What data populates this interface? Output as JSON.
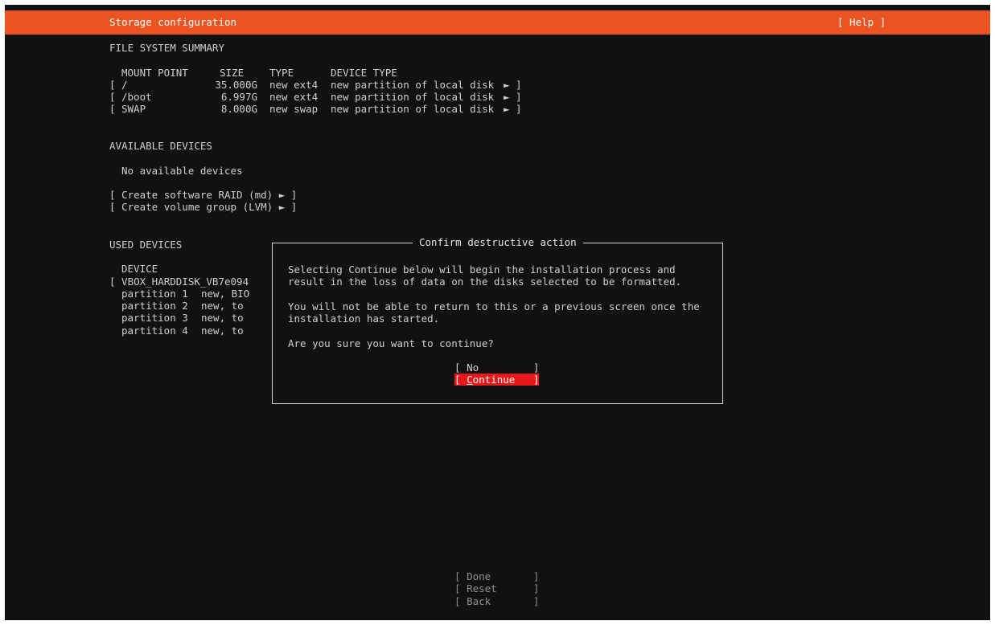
{
  "header": {
    "title": "Storage configuration",
    "help": "[ Help ]"
  },
  "fs_summary": {
    "heading": "FILE SYSTEM SUMMARY",
    "columns": {
      "mount": "MOUNT POINT",
      "size": "SIZE",
      "type": "TYPE",
      "device_type": "DEVICE TYPE"
    },
    "rows": [
      {
        "open": "[",
        "mount": "/",
        "size": "35.000G",
        "type": "new ext4",
        "device_type": "new partition of local disk",
        "arrow": "►",
        "close": "]"
      },
      {
        "open": "[",
        "mount": "/boot",
        "size": "6.997G",
        "type": "new ext4",
        "device_type": "new partition of local disk",
        "arrow": "►",
        "close": "]"
      },
      {
        "open": "[",
        "mount": "SWAP",
        "size": "8.000G",
        "type": "new swap",
        "device_type": "new partition of local disk",
        "arrow": "►",
        "close": "]"
      }
    ]
  },
  "available": {
    "heading": "AVAILABLE DEVICES",
    "empty": "No available devices",
    "actions": [
      "[ Create software RAID (md) ► ]",
      "[ Create volume group (LVM) ► ]"
    ]
  },
  "used": {
    "heading": "USED DEVICES",
    "column": "DEVICE",
    "disk": "[ VBOX_HARDDISK_VB7e094",
    "partitions": [
      {
        "name": "partition 1",
        "info": "new, BIO"
      },
      {
        "name": "partition 2",
        "info": "new, to"
      },
      {
        "name": "partition 3",
        "info": "new, to"
      },
      {
        "name": "partition 4",
        "info": "new, to"
      }
    ]
  },
  "dialog": {
    "title": "Confirm destructive action",
    "line1": "Selecting Continue below will begin the installation process and",
    "line2": "result in the loss of data on the disks selected to be formatted.",
    "line3": "You will not be able to return to this or a previous screen once the",
    "line4": "installation has started.",
    "question": "Are you sure you want to continue?",
    "no": {
      "open": "[ ",
      "label": "No",
      "close": "         ]"
    },
    "continue": {
      "open": "[ ",
      "first": "C",
      "rest": "ontinue",
      "close": "   ]"
    }
  },
  "footer": {
    "done": {
      "open": "[ ",
      "label": "Done",
      "close": "       ]"
    },
    "reset": {
      "open": "[ ",
      "label": "Reset",
      "close": "      ]"
    },
    "back": {
      "open": "[ ",
      "label": "Back",
      "close": "       ]"
    }
  },
  "colors": {
    "header_bg": "#e95420",
    "screen_bg": "#111111",
    "text": "#cfcfcf",
    "selected_button_bg": "#e81818"
  }
}
